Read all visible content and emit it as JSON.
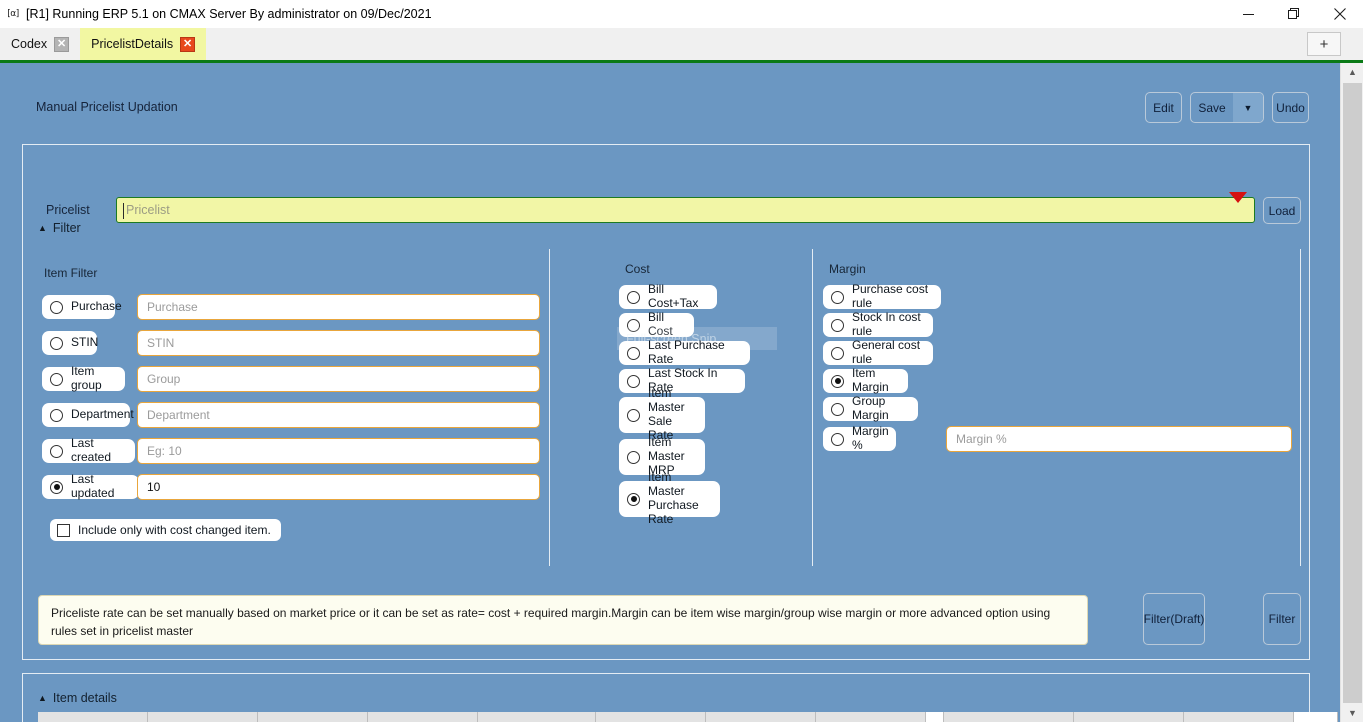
{
  "window": {
    "icon": "app-icon",
    "title": "[R1] Running ERP 5.1 on CMAX Server By administrator on 09/Dec/2021",
    "minimize": "—",
    "maximize": "❐",
    "close": "✕"
  },
  "tabs": {
    "items": [
      {
        "label": "Codex",
        "close": "✕",
        "active": false
      },
      {
        "label": "PricelistDetails",
        "close": "✕",
        "active": true
      }
    ],
    "add_label": "+"
  },
  "header": {
    "page_title": "Manual Pricelist Updation",
    "edit_label": "Edit",
    "save_label": "Save",
    "save_caret": "▼",
    "undo_label": "Undo"
  },
  "filter": {
    "section_label": "Filter",
    "collapse_glyph": "▲",
    "pricelist_label": "Pricelist",
    "pricelist_value": "",
    "pricelist_placeholder": "Pricelist",
    "pricelist_caret": "dropdown-caret",
    "load_label": "Load"
  },
  "item_filter": {
    "title": "Item Filter",
    "rows": [
      {
        "radio_label": "Purchase",
        "selected": false,
        "value": "",
        "placeholder": "Purchase"
      },
      {
        "radio_label": "STIN",
        "selected": false,
        "value": "",
        "placeholder": "STIN"
      },
      {
        "radio_label": "Item group",
        "selected": false,
        "value": "",
        "placeholder": "Group"
      },
      {
        "radio_label": "Department",
        "selected": false,
        "value": "",
        "placeholder": "Department"
      },
      {
        "radio_label": "Last created",
        "selected": false,
        "value": "",
        "placeholder": "Eg: 10"
      },
      {
        "radio_label": "Last updated",
        "selected": true,
        "value": "10",
        "placeholder": "Eg: 10"
      }
    ],
    "checkbox_label": "Include only with cost changed item.",
    "checkbox_checked": false
  },
  "cost": {
    "title": "Cost",
    "options": [
      {
        "label": "Bill Cost+Tax",
        "selected": false
      },
      {
        "label": "Bill Cost",
        "selected": false
      },
      {
        "label": "Last Purchase Rate",
        "selected": false
      },
      {
        "label": "Last Stock In Rate",
        "selected": false
      },
      {
        "label": "Item Master\nSale Rate",
        "selected": false,
        "line1": "Item Master",
        "line2": "Sale Rate"
      },
      {
        "label": "Item Master\nMRP",
        "selected": false,
        "line1": "Item Master",
        "line2": "MRP"
      },
      {
        "label": "Item Master\nPurchase Rate",
        "selected": true,
        "line1": "Item Master",
        "line2": "Purchase Rate"
      }
    ]
  },
  "margin": {
    "title": "Margin",
    "options": [
      {
        "label": "Purchase cost rule",
        "selected": false
      },
      {
        "label": "Stock In cost rule",
        "selected": false
      },
      {
        "label": "General cost rule",
        "selected": false
      },
      {
        "label": "Item Margin",
        "selected": true
      },
      {
        "label": "Group Margin",
        "selected": false
      },
      {
        "label": "Margin %",
        "selected": false
      }
    ],
    "margin_pct_value": "",
    "margin_pct_placeholder": "Margin %"
  },
  "info": {
    "text": "Priceliste rate can be set manually based on market price or it can be set as rate= cost + required margin.Margin can be item wise margin/group wise margin or more advanced option using rules set in pricelist master"
  },
  "actions": {
    "filter_draft_label": "Filter(Draft)",
    "filter_label": "Filter"
  },
  "item_details": {
    "section_label": "Item details",
    "collapse_glyph": "▲"
  },
  "overlay": {
    "snip_ghost_text": "Full-screen Snip"
  },
  "scrollbar": {
    "up_glyph": "▲",
    "down_glyph": "▼"
  },
  "colors": {
    "app_background": "#6b97c2",
    "active_tab": "#f2f7a2",
    "accent_green": "#0a7a16",
    "input_border": "#e9a63c",
    "pricelist_field": "#f2f6a6",
    "dropdown_caret": "#d61010",
    "info_background": "#fdfdf0"
  }
}
